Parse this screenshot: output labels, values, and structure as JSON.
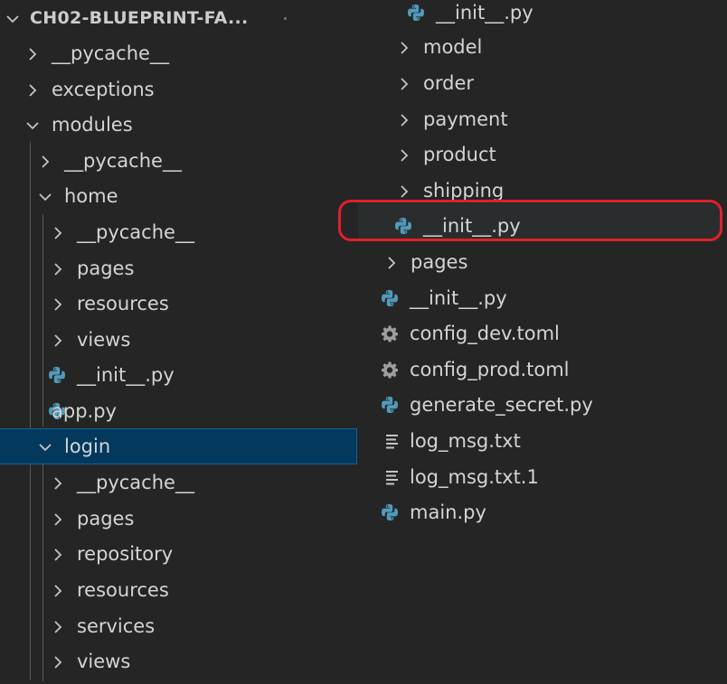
{
  "explorer": {
    "root_label": "CH02-BLUEPRINT-FA...",
    "left": [
      {
        "label": "__pycache__",
        "kind": "folder"
      },
      {
        "label": "exceptions",
        "kind": "folder"
      },
      {
        "label": "modules",
        "kind": "folder-open"
      },
      {
        "label": "__pycache__",
        "kind": "folder"
      },
      {
        "label": "home",
        "kind": "folder-open"
      },
      {
        "label": "__pycache__",
        "kind": "folder"
      },
      {
        "label": "pages",
        "kind": "folder"
      },
      {
        "label": "resources",
        "kind": "folder"
      },
      {
        "label": "views",
        "kind": "folder"
      },
      {
        "label": "__init__.py",
        "kind": "python"
      },
      {
        "label": "app.py",
        "kind": "python"
      },
      {
        "label": "login",
        "kind": "folder-open",
        "state": "selected"
      },
      {
        "label": "__pycache__",
        "kind": "folder"
      },
      {
        "label": "pages",
        "kind": "folder"
      },
      {
        "label": "repository",
        "kind": "folder"
      },
      {
        "label": "resources",
        "kind": "folder"
      },
      {
        "label": "services",
        "kind": "folder"
      },
      {
        "label": "views",
        "kind": "folder"
      }
    ],
    "right": [
      {
        "label": "__init__.py",
        "kind": "python"
      },
      {
        "label": "model",
        "kind": "folder"
      },
      {
        "label": "order",
        "kind": "folder"
      },
      {
        "label": "payment",
        "kind": "folder"
      },
      {
        "label": "product",
        "kind": "folder"
      },
      {
        "label": "shipping",
        "kind": "folder"
      },
      {
        "label": "__init__.py",
        "kind": "python",
        "state": "highlighted"
      },
      {
        "label": "pages",
        "kind": "folder"
      },
      {
        "label": "__init__.py",
        "kind": "python"
      },
      {
        "label": "config_dev.toml",
        "kind": "gear"
      },
      {
        "label": "config_prod.toml",
        "kind": "gear"
      },
      {
        "label": "generate_secret.py",
        "kind": "python"
      },
      {
        "label": "log_msg.txt",
        "kind": "text"
      },
      {
        "label": "log_msg.txt.1",
        "kind": "text"
      },
      {
        "label": "main.py",
        "kind": "python"
      }
    ]
  },
  "colors": {
    "background": "#252526",
    "selected_row": "#04395e",
    "text": "#d4d4d4",
    "python_icon": "#519aba",
    "highlight_ring": "#e0202a"
  }
}
